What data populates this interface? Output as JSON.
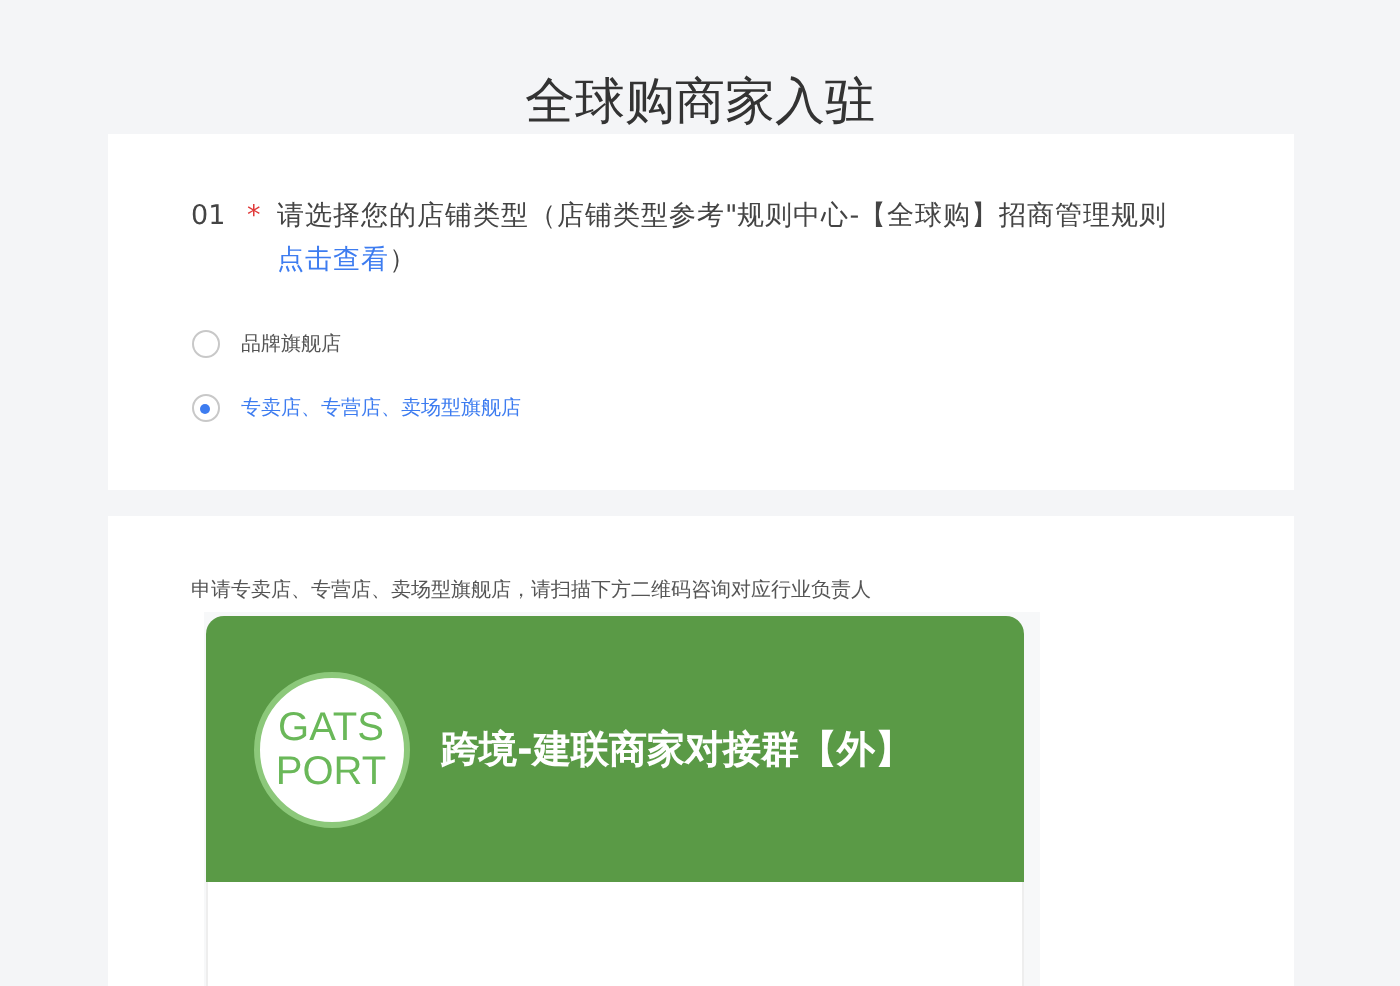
{
  "page_title": "全球购商家入驻",
  "question": {
    "number": "01",
    "required_mark": "*",
    "text": "请选择您的店铺类型（店铺类型参考\"规则中心-【全球购】招商管理规则 ",
    "link": "点击查看",
    "closing": "）",
    "options": [
      {
        "label": "品牌旗舰店",
        "selected": false
      },
      {
        "label": "专卖店、专营店、卖场型旗舰店",
        "selected": true
      }
    ]
  },
  "notice": {
    "text": "申请专卖店、专营店、卖场型旗舰店，请扫描下方二维码咨询对应行业负责人",
    "group_card": {
      "logo_lines": [
        "GATS",
        "PORT"
      ],
      "title": "跨境-建联商家对接群【外】"
    }
  }
}
